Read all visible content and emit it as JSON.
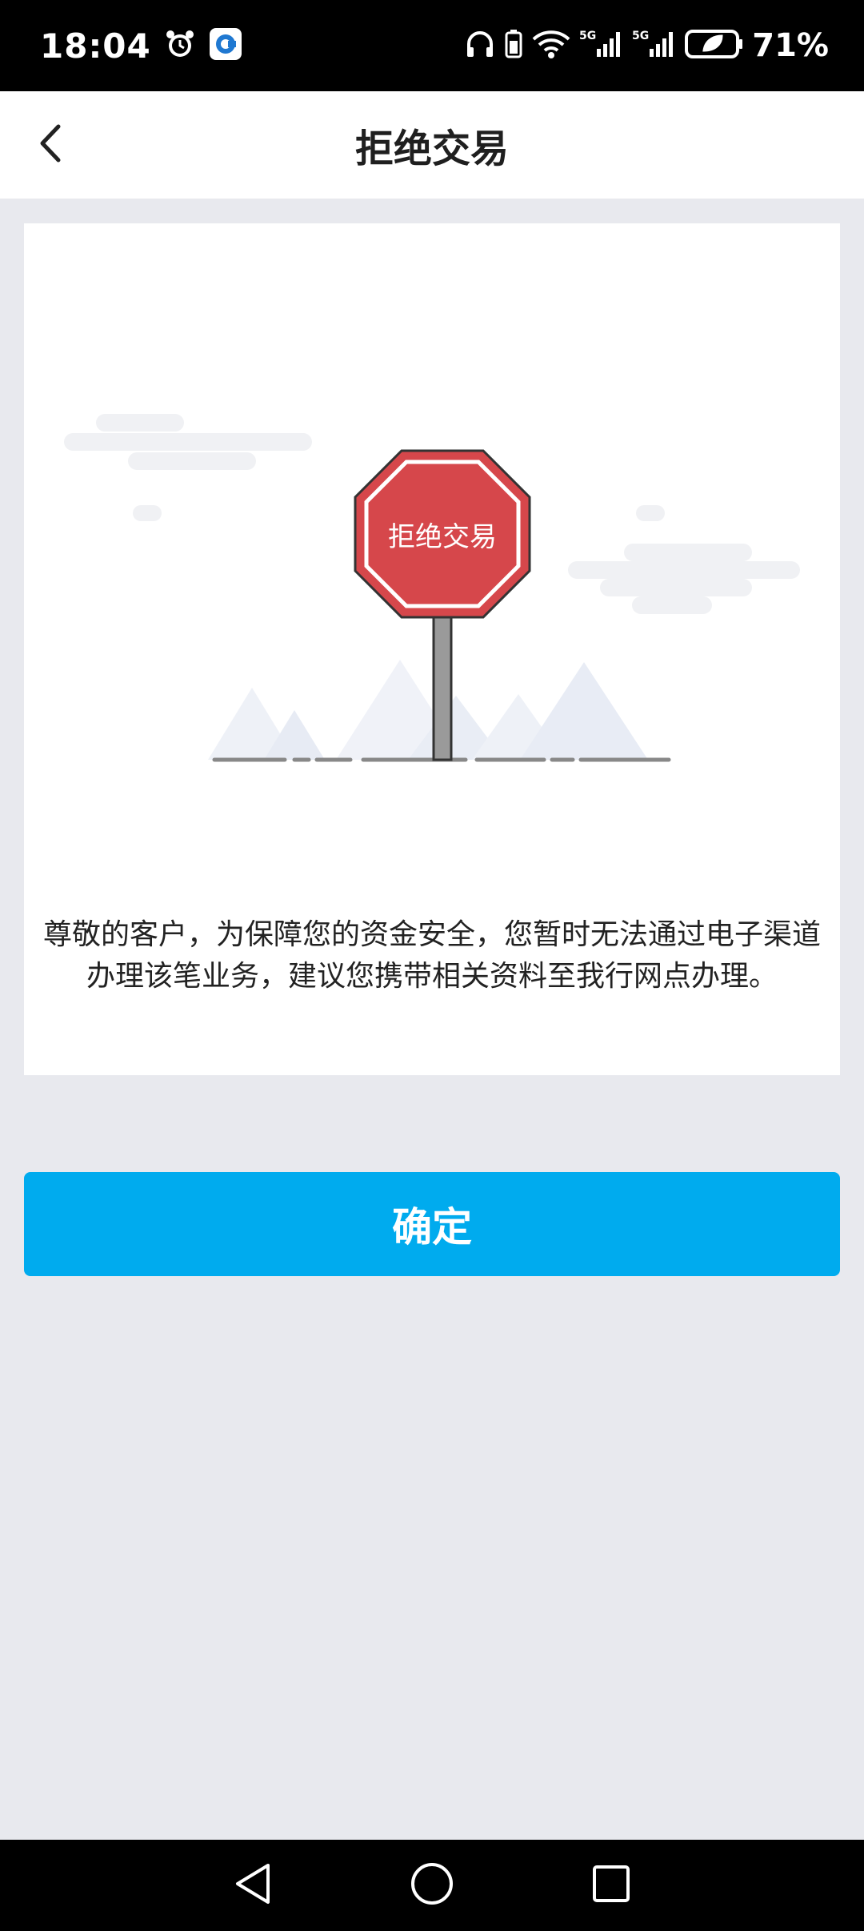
{
  "status_bar": {
    "time": "18:04",
    "battery_percent": "71%",
    "icons": [
      "alarm-icon",
      "app-notification-icon",
      "headphones-icon",
      "battery-saver-icon",
      "wifi-icon",
      "signal-5g-icon",
      "signal-5g-icon",
      "battery-icon"
    ]
  },
  "header": {
    "title": "拒绝交易",
    "back_icon": "chevron-left-icon"
  },
  "illustration": {
    "sign_text": "拒绝交易"
  },
  "message": "尊敬的客户，为保障您的资金安全，您暂时无法通过电子渠道办理该笔业务，建议您携带相关资料至我行网点办理。",
  "confirm_button": "确定",
  "colors": {
    "accent": "#00abee",
    "stop_sign": "#d6474b",
    "background": "#e8e9ee"
  },
  "system_nav": [
    "back-triangle-icon",
    "home-circle-icon",
    "recents-square-icon"
  ]
}
